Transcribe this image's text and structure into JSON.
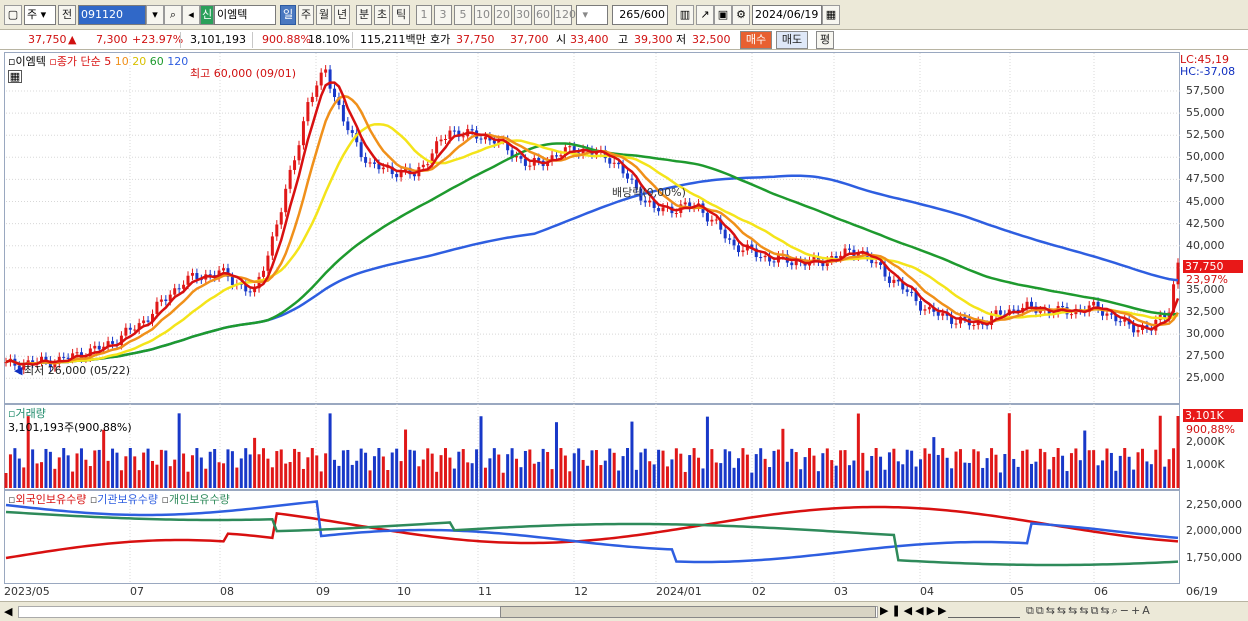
{
  "toolbar": {
    "mode_a": "주",
    "mode_b": "전",
    "code": "091120",
    "stock_badge": "신",
    "stock_name": "이엠텍",
    "periods": [
      "일",
      "주",
      "월",
      "년",
      "분",
      "초",
      "틱"
    ],
    "ticks": [
      "1",
      "3",
      "5",
      "10",
      "20",
      "30",
      "60",
      "120"
    ],
    "count": "265",
    "count_total": "/600",
    "date": "2024/06/19"
  },
  "quote": {
    "price": "37,750",
    "arrow": "▲",
    "change": "7,300",
    "pct": "+23.97%",
    "volume": "3,101,193",
    "vol_ratio": "900.88%",
    "turnover": "18.10%",
    "amount": "115,211백만",
    "hoga_label": "호가",
    "ask": "37,750",
    "bid": "37,700",
    "open_label": "시",
    "open": "33,400",
    "high_label": "고",
    "high": "39,300",
    "low_label": "저",
    "low": "32,500",
    "buy": "매수",
    "sell": "매도",
    "extra": "평"
  },
  "price_panel": {
    "name": "이엠텍",
    "legend_title": "종가 단순",
    "ma_periods": [
      "5",
      "10",
      "20",
      "60",
      "120"
    ],
    "ma_colors": [
      "#d81010",
      "#f0901a",
      "#f4e41a",
      "#1e9a2e",
      "#2e5ee0"
    ],
    "high_note": "최고 60,000 (09/01)",
    "low_note": "최저 26,000 (05/22)",
    "annot": "배당락(0,00%)",
    "lc": "LC:45,19",
    "hc": "HC:-37,08",
    "yticks": [
      "57,500",
      "55,000",
      "52,500",
      "50,000",
      "47,500",
      "45,000",
      "42,500",
      "40,000",
      "37,500",
      "35,000",
      "32,500",
      "30,000",
      "27,500",
      "25,000"
    ],
    "last_price": "37,750",
    "last_pct": "23,97%"
  },
  "volume_panel": {
    "title": "거래량",
    "sub": "3,101,193주(900,88%)",
    "yticks": [
      "2,000K",
      "1,000K"
    ],
    "last": "3,101K",
    "last_pct": "900,88%"
  },
  "holding_panel": {
    "series": [
      {
        "name": "외국인보유수량",
        "color": "#d81010"
      },
      {
        "name": "기관보유수량",
        "color": "#2e5ee0"
      },
      {
        "name": "개인보유수량",
        "color": "#2e8a5a"
      }
    ],
    "yticks": [
      "2,250,000",
      "2,000,000",
      "1,750,000"
    ]
  },
  "xaxis": [
    "2023/05",
    "07",
    "08",
    "09",
    "10",
    "11",
    "12",
    "2024/01",
    "02",
    "03",
    "04",
    "05",
    "06",
    "06/19"
  ]
}
